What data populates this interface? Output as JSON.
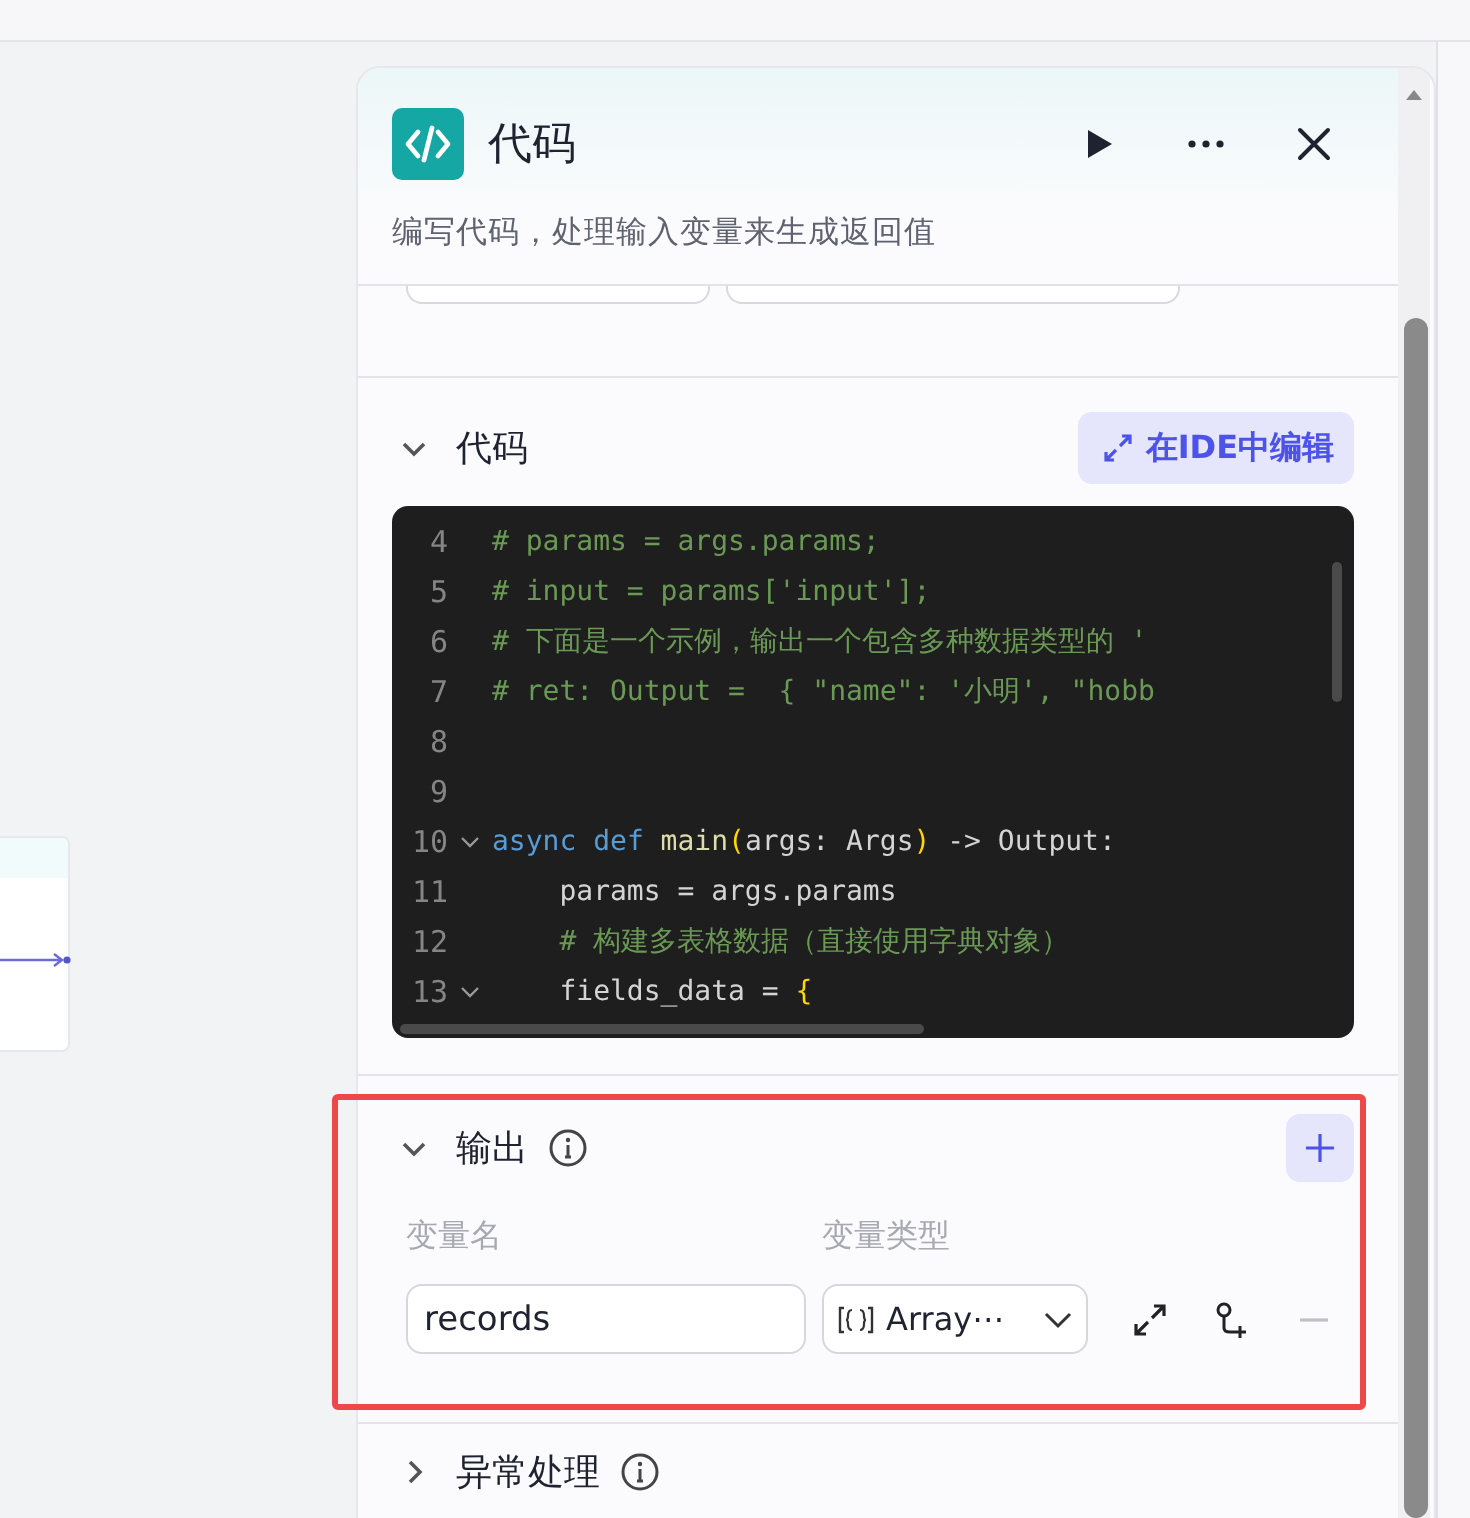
{
  "panel": {
    "title": "代码",
    "description": "编写代码，处理输入变量来生成返回值"
  },
  "code_section": {
    "title": "代码",
    "expanded": true,
    "ide_button": "在IDE中编辑",
    "lines": [
      {
        "number": "4",
        "fold": false,
        "tokens": [
          {
            "kind": "comment",
            "text": "# params = args.params;"
          }
        ]
      },
      {
        "number": "5",
        "fold": false,
        "tokens": [
          {
            "kind": "comment",
            "text": "# input = params['input'];"
          }
        ]
      },
      {
        "number": "6",
        "fold": false,
        "tokens": [
          {
            "kind": "comment",
            "text": "# 下面是一个示例，输出一个包含多种数据类型的 '"
          }
        ]
      },
      {
        "number": "7",
        "fold": false,
        "tokens": [
          {
            "kind": "comment",
            "text": "# ret: Output =  { \"name\": '小明', \"hobb"
          }
        ]
      },
      {
        "number": "8",
        "fold": false
      },
      {
        "number": "9",
        "fold": false
      },
      {
        "number": "10",
        "fold": true,
        "tokens": [
          {
            "kind": "keyword",
            "text": "async"
          },
          {
            "kind": "keyword",
            "text": " def"
          },
          {
            "kind": "function",
            "text": " main"
          },
          {
            "kind": "bracket",
            "text": "("
          },
          {
            "kind": "plain",
            "text": "args: Args"
          },
          {
            "kind": "bracket",
            "text": ")"
          },
          {
            "kind": "plain",
            "text": " -> Output:"
          }
        ]
      },
      {
        "number": "11",
        "fold": false,
        "tokens": [
          {
            "kind": "plain",
            "text": "    params = args.params"
          }
        ]
      },
      {
        "number": "12",
        "fold": false,
        "tokens": [
          {
            "kind": "comment",
            "text": "    # 构建多表格数据（直接使用字典对象）"
          }
        ]
      },
      {
        "number": "13",
        "fold": true,
        "tokens": [
          {
            "kind": "plain",
            "text": "    fields_data = "
          },
          {
            "kind": "bracket",
            "text": "{"
          }
        ]
      }
    ]
  },
  "output_section": {
    "title": "输出",
    "expanded": true,
    "columns": [
      "变量名",
      "变量类型"
    ],
    "rows": [
      {
        "name": "records",
        "type": "Array⋯"
      }
    ]
  },
  "exception_section": {
    "title": "异常处理",
    "expanded": false
  }
}
